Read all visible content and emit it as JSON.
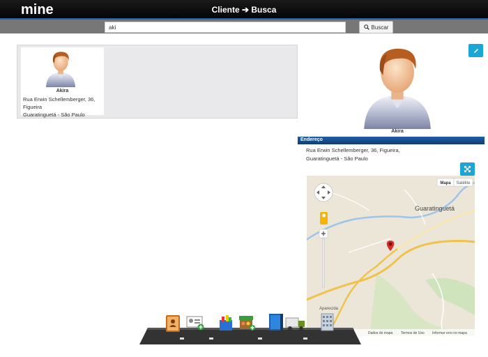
{
  "header": {
    "logo": "mine",
    "title": "Cliente ➔ Busca"
  },
  "search": {
    "value": "aki",
    "button_label": "Buscar"
  },
  "results": [
    {
      "name": "Akira",
      "address_line1": "Rua Erwin Schellemberger, 36,",
      "address_line2": "Figueira",
      "address_line3": "Guaratinguetá - São Paulo"
    }
  ],
  "profile": {
    "name": "Akira",
    "section_title": "Endereço",
    "address_line1": "Rua Erwin Schellemberger, 36, Figueira,",
    "address_line2": "Guaratinguetá - São Paulo"
  },
  "map": {
    "type_map": "Mapa",
    "type_satellite": "Satélite",
    "city_label": "Guaratinguetá",
    "town_label": "Aparecida",
    "footer_data": "Dados do mapa",
    "footer_terms": "Termos de Uso",
    "footer_report": "Informar erro no mapa"
  },
  "colors": {
    "accent": "#1aa6d6",
    "header_blue": "#1f5fa8"
  }
}
